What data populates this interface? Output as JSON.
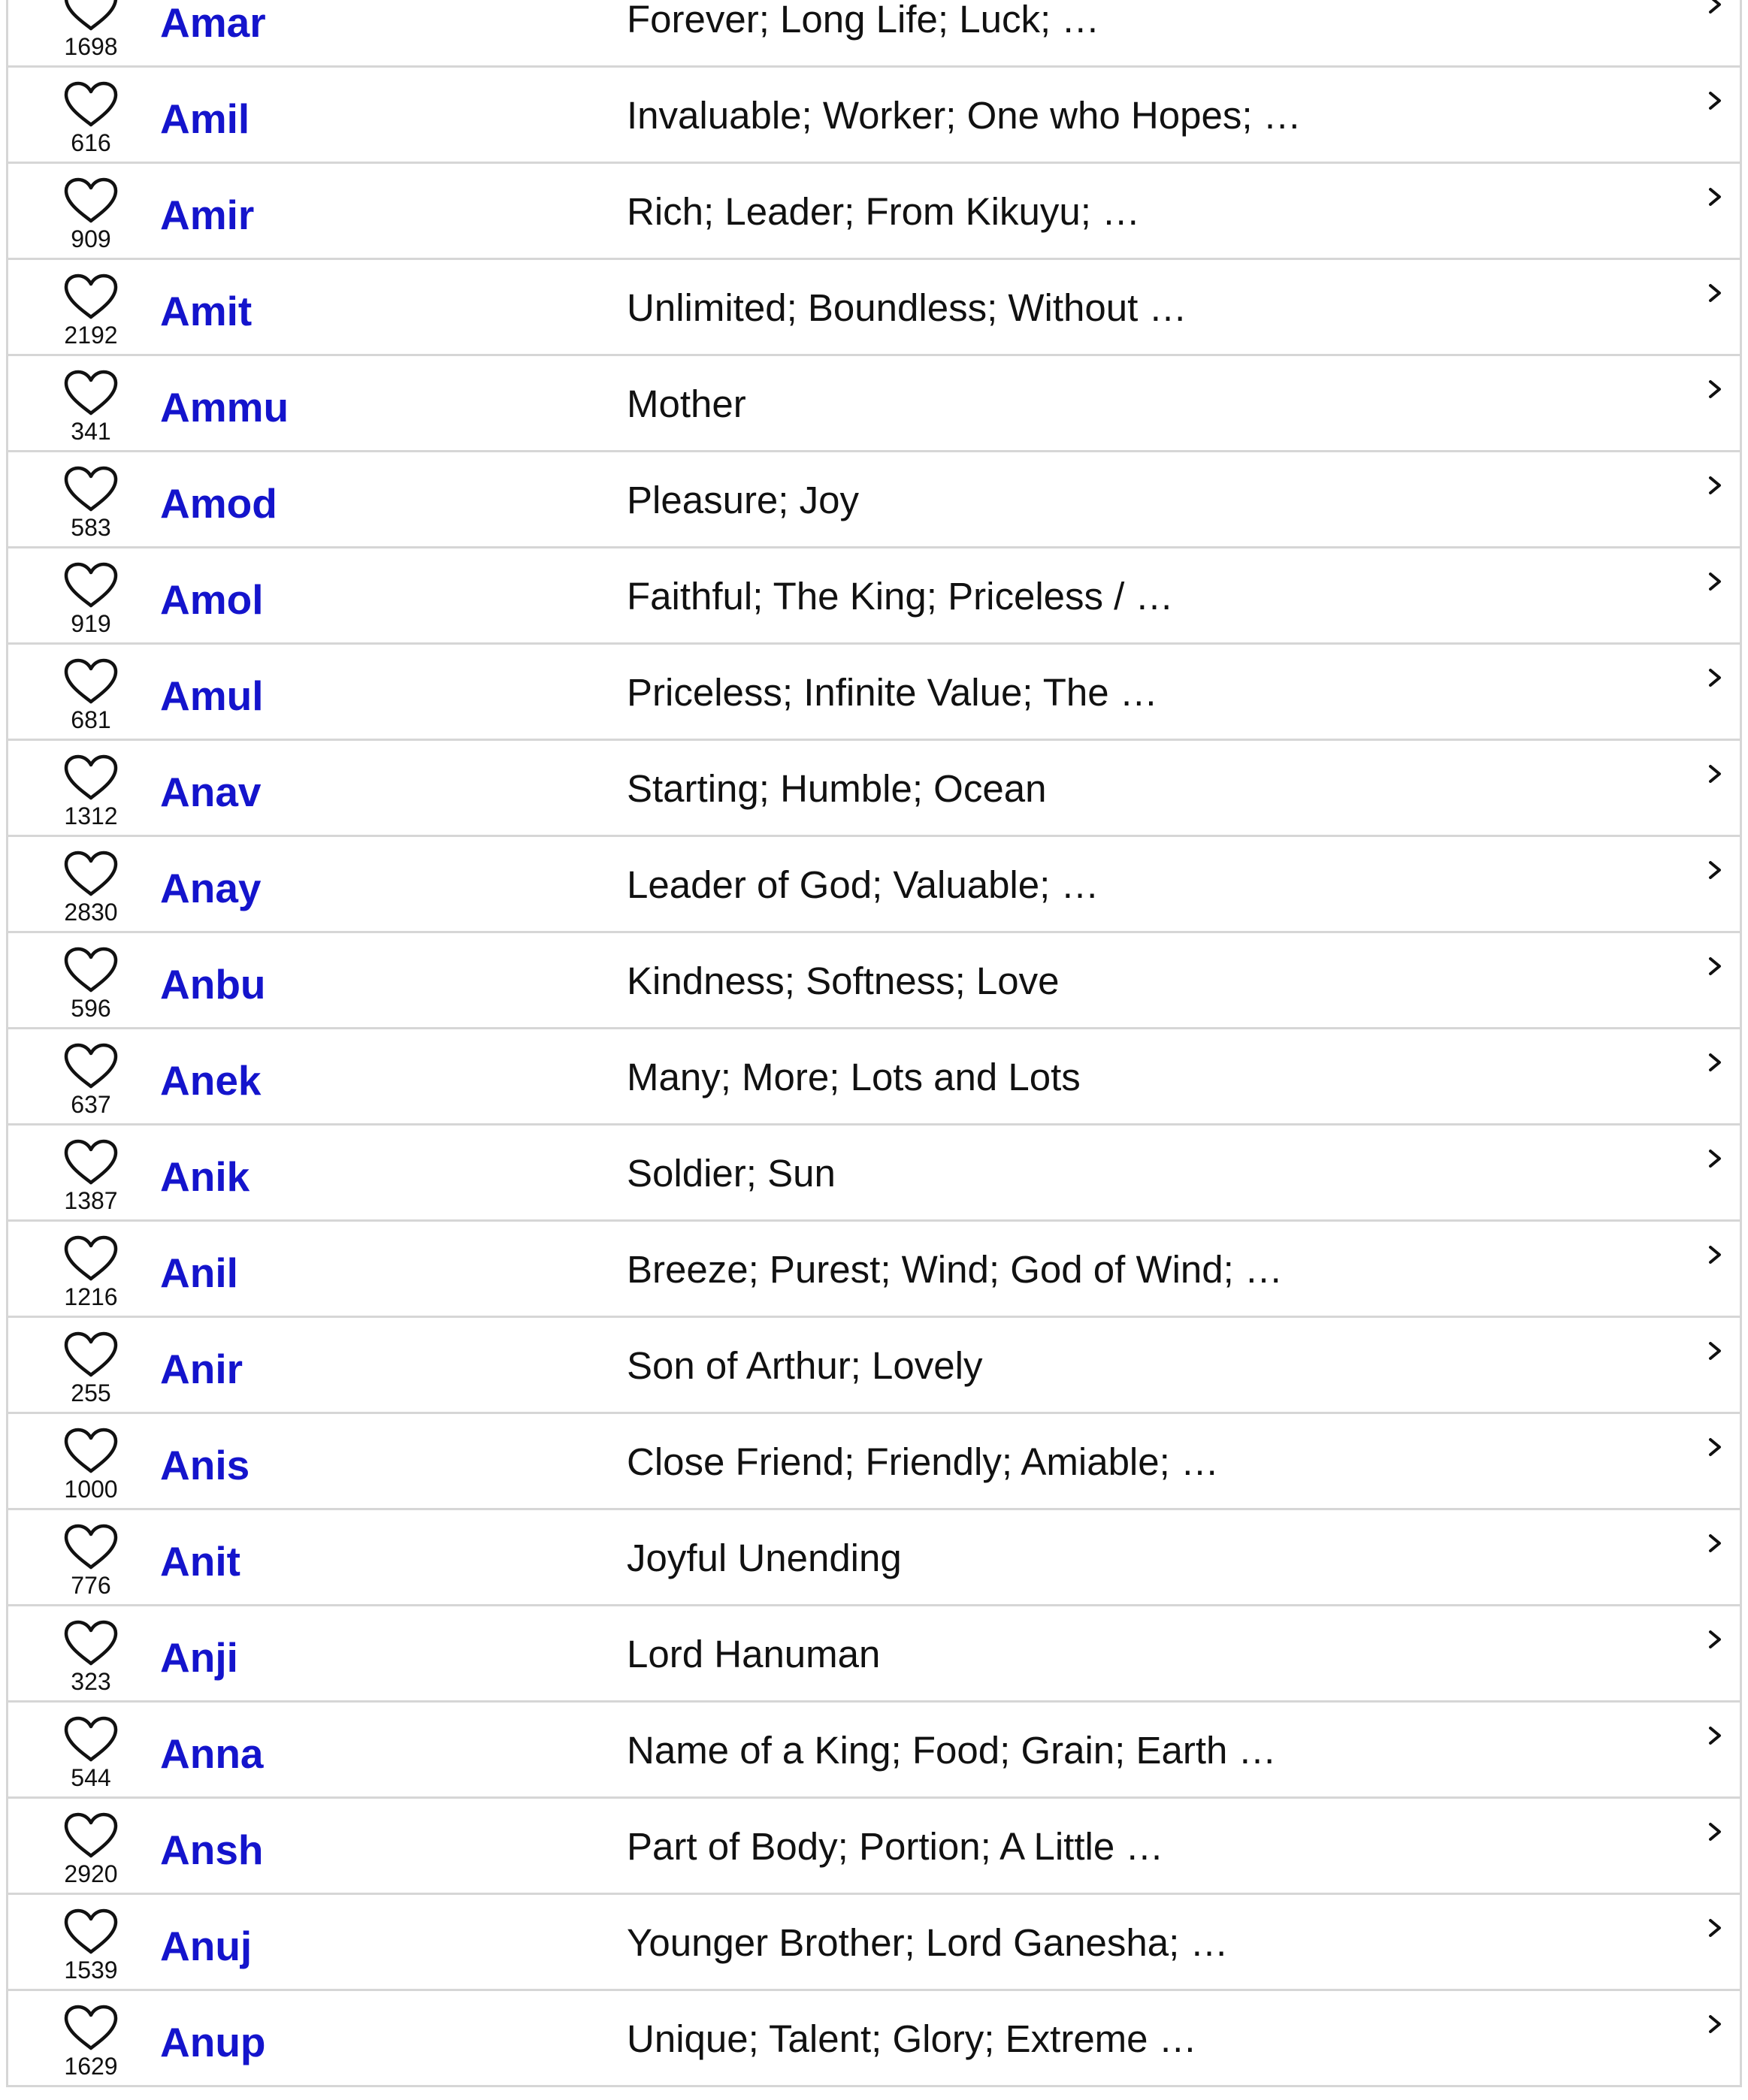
{
  "names": [
    {
      "name": "Amar",
      "meaning": "Forever; Long Life; Luck; …",
      "likes": "1698"
    },
    {
      "name": "Amil",
      "meaning": "Invaluable; Worker; One who Hopes; …",
      "likes": "616"
    },
    {
      "name": "Amir",
      "meaning": "Rich; Leader; From Kikuyu; …",
      "likes": "909"
    },
    {
      "name": "Amit",
      "meaning": "Unlimited; Boundless; Without …",
      "likes": "2192"
    },
    {
      "name": "Ammu",
      "meaning": "Mother",
      "likes": "341"
    },
    {
      "name": "Amod",
      "meaning": "Pleasure; Joy",
      "likes": "583"
    },
    {
      "name": "Amol",
      "meaning": "Faithful; The King; Priceless / …",
      "likes": "919"
    },
    {
      "name": "Amul",
      "meaning": "Priceless; Infinite Value; The …",
      "likes": "681"
    },
    {
      "name": "Anav",
      "meaning": "Starting; Humble; Ocean",
      "likes": "1312"
    },
    {
      "name": "Anay",
      "meaning": "Leader of God; Valuable; …",
      "likes": "2830"
    },
    {
      "name": "Anbu",
      "meaning": "Kindness; Softness; Love",
      "likes": "596"
    },
    {
      "name": "Anek",
      "meaning": "Many; More; Lots and Lots",
      "likes": "637"
    },
    {
      "name": "Anik",
      "meaning": "Soldier; Sun",
      "likes": "1387"
    },
    {
      "name": "Anil",
      "meaning": "Breeze; Purest; Wind; God of Wind; …",
      "likes": "1216"
    },
    {
      "name": "Anir",
      "meaning": "Son of Arthur; Lovely",
      "likes": "255"
    },
    {
      "name": "Anis",
      "meaning": "Close Friend; Friendly; Amiable; …",
      "likes": "1000"
    },
    {
      "name": "Anit",
      "meaning": "Joyful Unending",
      "likes": "776"
    },
    {
      "name": "Anji",
      "meaning": "Lord Hanuman",
      "likes": "323"
    },
    {
      "name": "Anna",
      "meaning": "Name of a King; Food; Grain; Earth …",
      "likes": "544"
    },
    {
      "name": "Ansh",
      "meaning": "Part of Body; Portion; A Little …",
      "likes": "2920"
    },
    {
      "name": "Anuj",
      "meaning": "Younger Brother; Lord Ganesha; …",
      "likes": "1539"
    },
    {
      "name": "Anup",
      "meaning": "Unique; Talent; Glory; Extreme …",
      "likes": "1629"
    }
  ],
  "icons": {
    "favorite": "heart-outline-icon",
    "open": "chevron-right-icon"
  },
  "colors": {
    "name_link": "#1414cc",
    "text": "#111111",
    "divider": "#d6d6d6"
  }
}
